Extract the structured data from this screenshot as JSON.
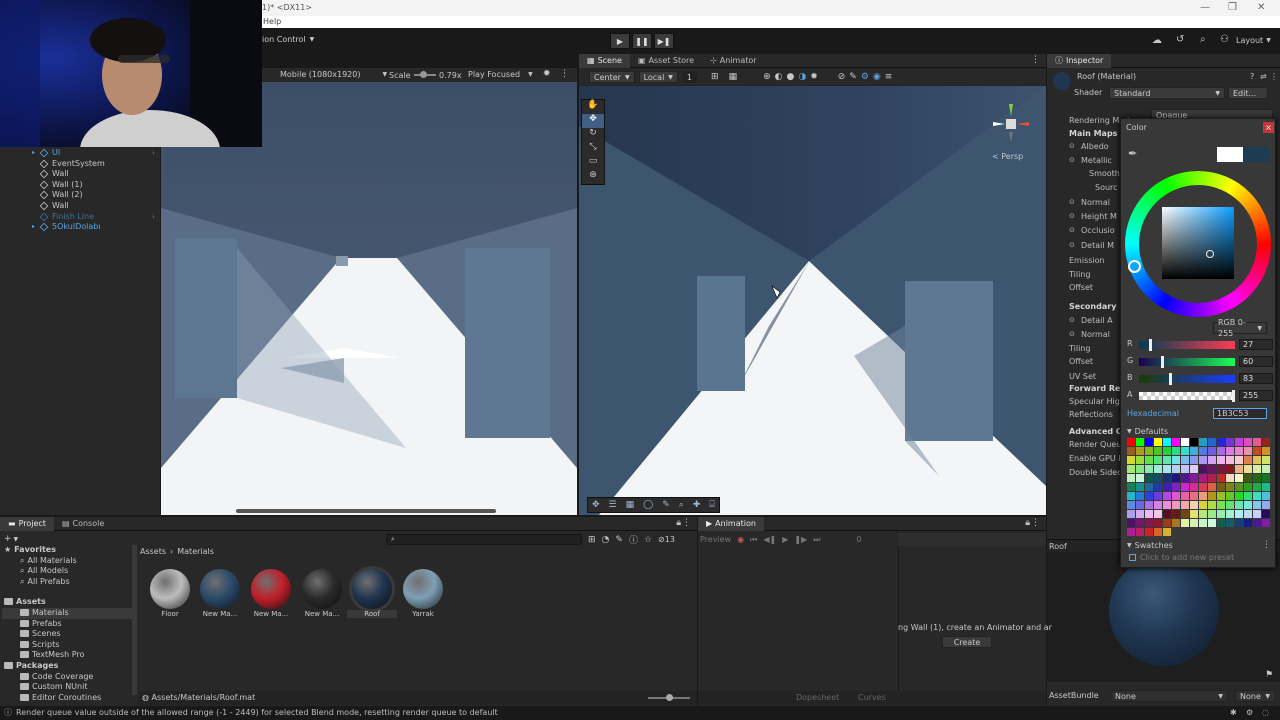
{
  "window": {
    "title_fragment": "1)* <DX11>",
    "menu_fragment": "Help",
    "controls": [
      "—",
      "❐",
      "✕"
    ]
  },
  "toolbar": {
    "version_control": "ion Control",
    "layout_label": "Layout",
    "play_icon": "play-icon",
    "pause_icon": "pause-icon",
    "step_icon": "step-icon"
  },
  "hierarchy": {
    "items": [
      {
        "label": "UI",
        "color": "#5aa5e8"
      },
      {
        "label": "EventSystem",
        "color": "#c8c8c8"
      },
      {
        "label": "Wall",
        "color": "#c8c8c8"
      },
      {
        "label": "Wall (1)",
        "color": "#c8c8c8"
      },
      {
        "label": "Wall (2)",
        "color": "#c8c8c8"
      },
      {
        "label": "Wall",
        "color": "#c8c8c8"
      },
      {
        "label": "Finish Line",
        "color": "#3f6f9a"
      },
      {
        "label": "5OkulDolabı",
        "color": "#5aa5e8"
      }
    ]
  },
  "game": {
    "resolution": "Mobile (1080x1920)",
    "scale_label": "Scale",
    "scale_value": "0.79x",
    "play_focused": "Play Focused"
  },
  "scene": {
    "tabs": [
      "Scene",
      "Asset Store",
      "Animator"
    ],
    "pivot": "Center",
    "space": "Local",
    "grid_value": "1",
    "persp_label": "< Persp"
  },
  "inspector": {
    "tab": "Inspector",
    "material_name": "Roof (Material)",
    "shader_label": "Shader",
    "shader_value": "Standard",
    "edit_label": "Edit...",
    "rows": [
      "Rendering Mode",
      "Main Maps",
      "Albedo",
      "Metallic",
      "Smooth",
      "Sourc",
      "Normal",
      "Height M",
      "Occlusio",
      "Detail M",
      "Emission",
      "Tiling",
      "Offset",
      "Secondary M",
      "Detail A",
      "Normal",
      "Tiling",
      "Offset",
      "UV Set",
      "Forward Rend",
      "Specular Hig",
      "Reflections",
      "Advanced Op",
      "Render Queue",
      "Enable GPU I",
      "Double Sided"
    ],
    "rendering_mode_value": "Opaque",
    "preview_label": "Roof",
    "assetbundle_label": "AssetBundle",
    "assetbundle_value": "None",
    "assetbundle_variant": "None"
  },
  "picker": {
    "title": "Color",
    "mode": "RGB 0-255",
    "channels": [
      {
        "label": "R",
        "value": "27",
        "fraction": 0.106
      },
      {
        "label": "G",
        "value": "60",
        "fraction": 0.235
      },
      {
        "label": "B",
        "value": "83",
        "fraction": 0.325
      },
      {
        "label": "A",
        "value": "255",
        "fraction": 1.0
      }
    ],
    "hex_label": "Hexadecimal",
    "hex_value": "1B3C53",
    "defaults_label": "Defaults",
    "swatches_label": "Swatches",
    "add_preset": "Click to add new preset",
    "current_color": "#1B3C53"
  },
  "project": {
    "tabs": [
      "Project",
      "Console"
    ],
    "favorites_label": "Favorites",
    "favorites": [
      "All Materials",
      "All Models",
      "All Prefabs"
    ],
    "assets_label": "Assets",
    "asset_folders": [
      "Materials",
      "Prefabs",
      "Scenes",
      "Scripts",
      "TextMesh Pro"
    ],
    "packages_label": "Packages",
    "packages": [
      "Code Coverage",
      "Custom NUnit",
      "Editor Coroutines"
    ],
    "breadcrumb": [
      "Assets",
      "Materials"
    ],
    "count": "13",
    "materials": [
      {
        "name": "Floor",
        "color": "#bdbdbd"
      },
      {
        "name": "New Ma...",
        "color": "#2b4a6a"
      },
      {
        "name": "New Ma...",
        "color": "#c0202a"
      },
      {
        "name": "New Ma...",
        "color": "#2a2a2a"
      },
      {
        "name": "Roof",
        "color": "#1f3550"
      },
      {
        "name": "Yarrak",
        "color": "#7f9fb5"
      }
    ],
    "footer_path": "Assets/Materials/Roof.mat"
  },
  "animation": {
    "tab": "Animation",
    "preview_label": "Preview",
    "frame": "0",
    "message": "ng Wall (1), create an Animator and ar",
    "create_label": "Create",
    "dopesheet": "Dopesheet",
    "curves": "Curves"
  },
  "status": {
    "message": "Render queue value outside of the allowed range (-1 - 2449) for selected Blend mode, resetting render queue to default"
  }
}
